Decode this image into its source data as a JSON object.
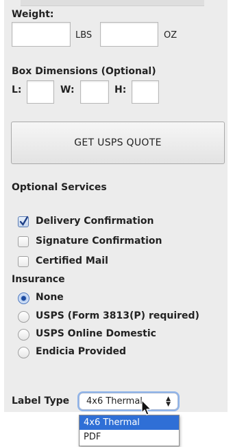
{
  "weight": {
    "label": "Weight:",
    "lbs_value": "",
    "lbs_unit": "LBS",
    "oz_value": "",
    "oz_unit": "OZ"
  },
  "box": {
    "label": "Box Dimensions (Optional)",
    "l_label": "L:",
    "w_label": "W:",
    "h_label": "H:",
    "l_value": "",
    "w_value": "",
    "h_value": ""
  },
  "quote_button": "GET USPS QUOTE",
  "optional_services": {
    "heading": "Optional Services",
    "items": [
      {
        "label": "Delivery Confirmation",
        "checked": true
      },
      {
        "label": "Signature Confirmation",
        "checked": false
      },
      {
        "label": "Certified Mail",
        "checked": false
      }
    ]
  },
  "insurance": {
    "heading": "Insurance",
    "options": [
      {
        "label": "None",
        "selected": true
      },
      {
        "label": "USPS (Form 3813(P) required)",
        "selected": false
      },
      {
        "label": "USPS Online Domestic",
        "selected": false
      },
      {
        "label": "Endicia Provided",
        "selected": false
      }
    ]
  },
  "label_type": {
    "label": "Label Type",
    "selected": "4x6 Thermal",
    "options": [
      "4x6 Thermal",
      "PDF"
    ],
    "highlighted": "4x6 Thermal"
  },
  "colors": {
    "panel_bg": "#ececec",
    "accent": "#2f6fd6"
  }
}
